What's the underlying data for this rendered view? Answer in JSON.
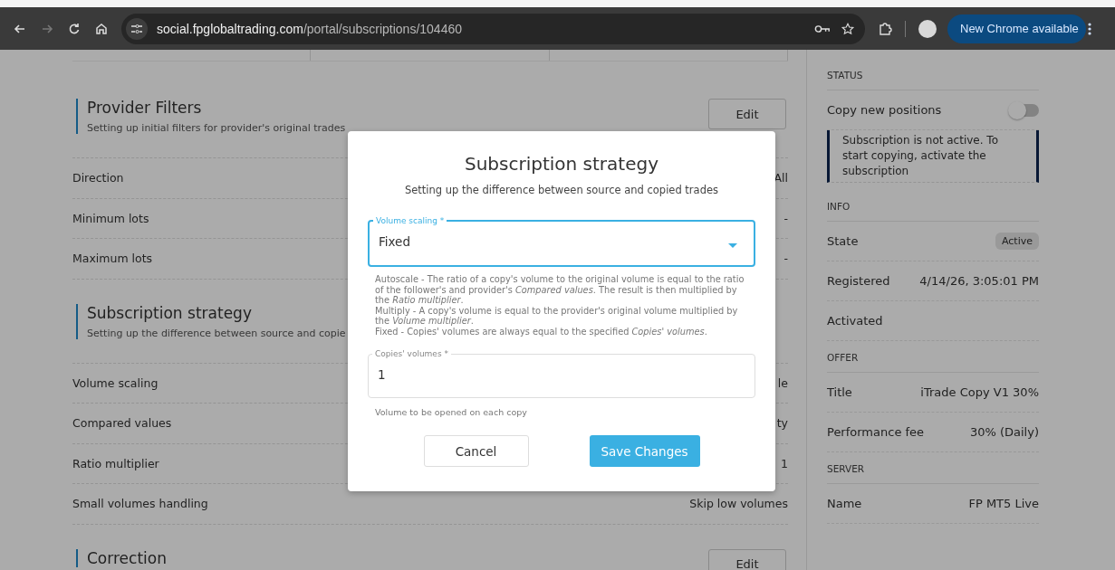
{
  "browser": {
    "address": {
      "domain": "social.fpglobaltrading.com",
      "path": "/portal/subscriptions/104460"
    },
    "update_button": "New Chrome available",
    "forward_disabled": true
  },
  "sections": [
    {
      "title": "Provider Filters",
      "description": "Setting up initial filters for provider's original trades",
      "edit": "Edit",
      "rows": [
        {
          "label": "Direction",
          "value": "All"
        },
        {
          "label": "Minimum lots",
          "value": "-"
        },
        {
          "label": "Maximum lots",
          "value": "-"
        }
      ]
    },
    {
      "title": "Subscription strategy",
      "description": "Setting up the difference between source and copie",
      "rows": [
        {
          "label": "Volume scaling",
          "value": "le"
        },
        {
          "label": "Compared values",
          "value": "ty"
        },
        {
          "label": "Ratio multiplier",
          "value": "1"
        },
        {
          "label": "Small volumes handling",
          "value": "Skip low volumes"
        }
      ]
    },
    {
      "title": "Correction",
      "edit": "Edit"
    }
  ],
  "side": [
    {
      "heading": "STATUS",
      "items": [
        {
          "kind": "toggle",
          "label": "Copy new positions",
          "on": false
        },
        {
          "kind": "notice",
          "text": "Subscription is not active. To start copying, activate the subscription"
        }
      ]
    },
    {
      "heading": "INFO",
      "items": [
        {
          "kind": "badge",
          "label": "State",
          "value": "Active"
        },
        {
          "kind": "pair",
          "label": "Registered",
          "value": "4/14/26, 3:05:01 PM"
        },
        {
          "kind": "pair",
          "label": "Activated"
        }
      ]
    },
    {
      "heading": "OFFER",
      "items": [
        {
          "kind": "pair",
          "label": "Title",
          "value": "iTrade Copy V1 30%"
        },
        {
          "kind": "pair",
          "label": "Performance fee",
          "value": "30% (Daily)"
        }
      ]
    },
    {
      "heading": "SERVER",
      "items": [
        {
          "kind": "pair",
          "label": "Name",
          "value": "FP MT5 Live"
        }
      ]
    }
  ],
  "dialog": {
    "title": "Subscription strategy",
    "subtitle": "Setting up the difference between source and copied trades",
    "select": {
      "label": "Volume scaling *",
      "value": "Fixed",
      "focused": true
    },
    "help": [
      "Autoscale - The ratio of a copy's volume to the original volume is equal to the ratio of the follower's and provider's *Compared values*. The result is then multiplied by the *Ratio multiplier*.",
      "Multiply - A copy's volume is equal to the provider's original volume multiplied by the *Volume multiplier*.",
      "Fixed - Copies' volumes are always equal to the specified *Copies' volumes*."
    ],
    "field": {
      "label": "Copies' volumes *",
      "value": "1",
      "hint": "Volume to be opened on each copy"
    },
    "cancel": "Cancel",
    "save": "Save Changes"
  }
}
